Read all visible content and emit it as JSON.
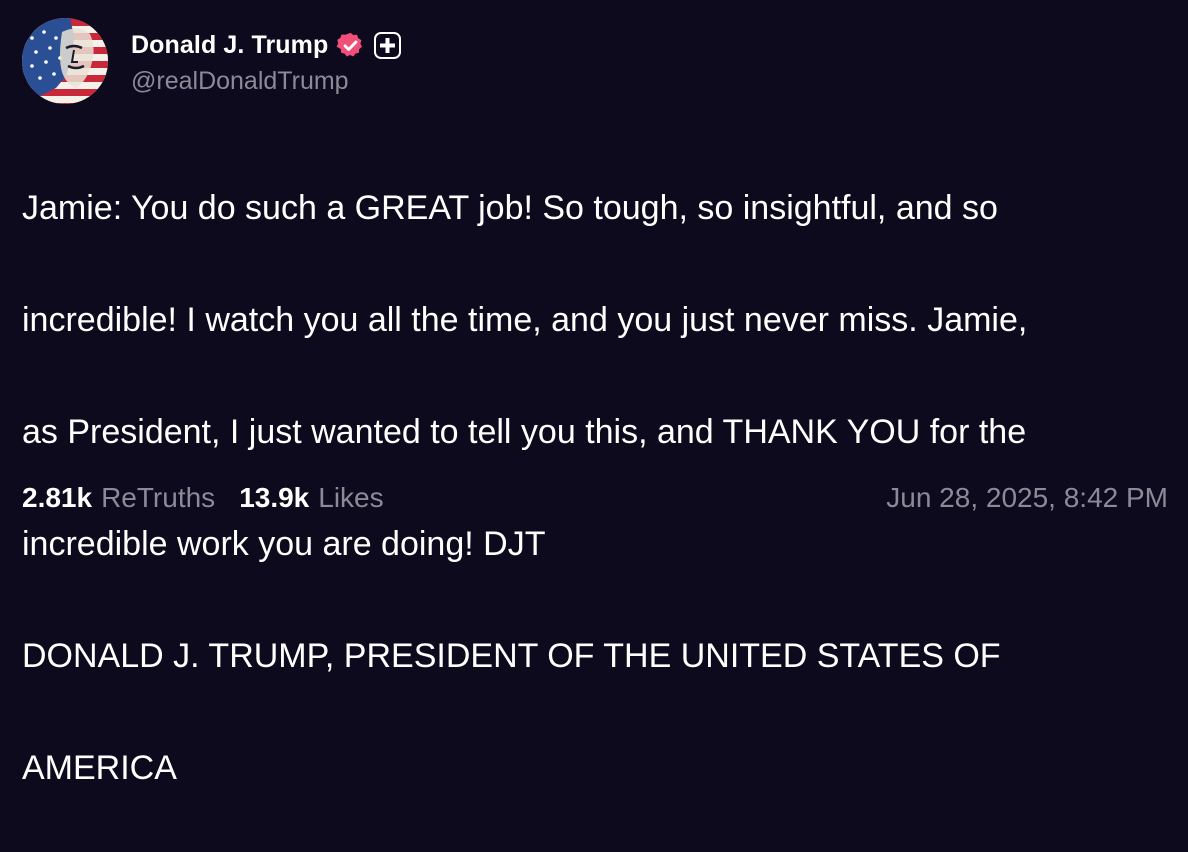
{
  "post": {
    "author": {
      "display_name": "Donald J. Trump",
      "handle": "@realDonaldTrump",
      "avatar_icon": "flag-portrait-avatar",
      "verified_icon": "verified-badge-icon",
      "verified_color": "#ef4f78",
      "plus_icon": "truth-plus-icon"
    },
    "text_lines": [
      "Jamie: You do such a GREAT job! So tough, so insightful, and so",
      "incredible! I watch you all the time, and you just never miss. Jamie,",
      "as President, I just wanted to tell you this, and THANK YOU for the",
      "incredible work you are doing! DJT",
      "DONALD J. TRUMP, PRESIDENT OF THE UNITED STATES OF",
      "AMERICA"
    ],
    "stats": {
      "retruths_count": "2.81k",
      "retruths_label": "ReTruths",
      "likes_count": "13.9k",
      "likes_label": "Likes"
    },
    "timestamp": "Jun 28, 2025, 8:42 PM"
  },
  "colors": {
    "background": "#0c0a1c",
    "primary_text": "#ffffff",
    "secondary_text": "#8b8a97",
    "accent": "#ef4f78"
  }
}
